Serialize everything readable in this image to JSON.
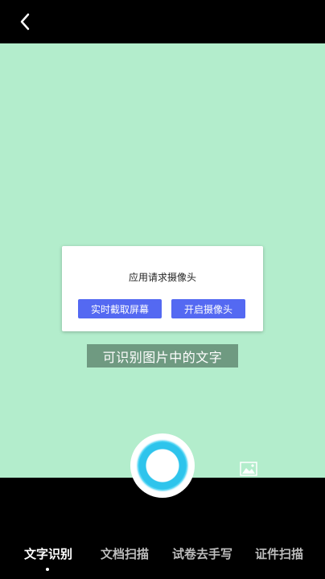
{
  "dialog": {
    "title": "应用请求摄像头",
    "left_button": "实时截取屏幕",
    "right_button": "开启摄像头"
  },
  "hint_text": "可识别图片中的文字",
  "tabs": [
    {
      "label": "文字识别",
      "active": true
    },
    {
      "label": "文档扫描",
      "active": false
    },
    {
      "label": "试卷去手写",
      "active": false
    },
    {
      "label": "证件扫描",
      "active": false
    }
  ],
  "icons": {
    "back": "chevron-left-icon",
    "gallery": "image-icon"
  },
  "colors": {
    "camera_background": "#b3edcc",
    "primary_button": "#5469f2",
    "shutter_accent": "#2ec4ec"
  }
}
